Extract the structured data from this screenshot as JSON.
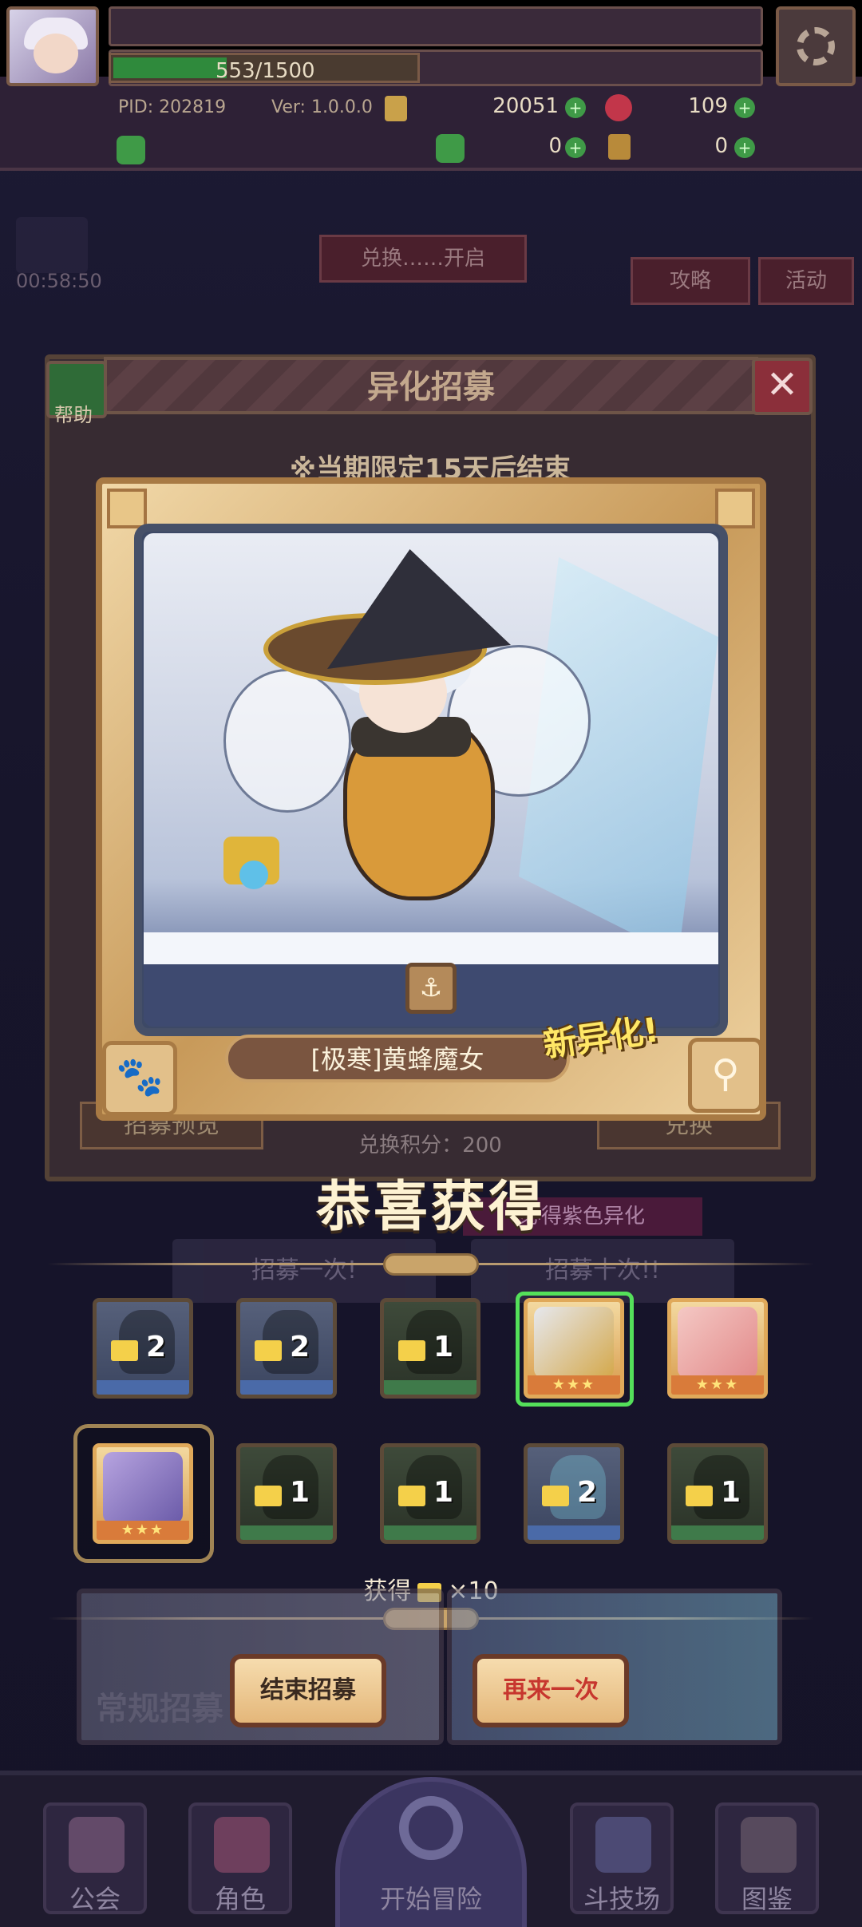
{
  "hud": {
    "pid": "PID: 202819",
    "version": "Ver: 1.0.0.0",
    "coins": "20051",
    "gems": "109",
    "xp_text": "553/1500",
    "xp_fraction": 0.369,
    "clover_count": "0",
    "key_count": "0"
  },
  "background": {
    "timer": "00:58:50",
    "strategy_label": "攻略",
    "activity_label": "活动",
    "exchange_open": "兑换……开启"
  },
  "window": {
    "title": "异化招募",
    "help_label": "帮助",
    "close_glyph": "✕",
    "limit_notice": "※当期限定15天后结束",
    "exchange_points": "兑换积分：200",
    "preview_label": "招募预览",
    "exchange_label": "兑换",
    "purple_hint": "必得紫色异化",
    "recruit_one": "招募一次!",
    "recruit_ten": "招募十次!!"
  },
  "card": {
    "character_name": "[极寒]黄蜂魔女",
    "new_badge": "新异化!",
    "paw_glyph": "🐾",
    "weapon_glyph": "⚲",
    "element_glyph": "⚓"
  },
  "result": {
    "title": "恭喜获得",
    "rewards_row1": [
      {
        "type": "shard",
        "rarity": "blue",
        "count": "2"
      },
      {
        "type": "shard",
        "rarity": "blue",
        "count": "2"
      },
      {
        "type": "shard",
        "rarity": "green",
        "count": "1"
      },
      {
        "type": "hero",
        "stars": "★★★",
        "highlight": "new"
      },
      {
        "type": "hero",
        "stars": "★★★"
      }
    ],
    "rewards_row2": [
      {
        "type": "hero",
        "stars": "★★★",
        "highlight": "selected"
      },
      {
        "type": "shard",
        "rarity": "green",
        "count": "1"
      },
      {
        "type": "shard",
        "rarity": "green",
        "count": "1"
      },
      {
        "type": "shard",
        "rarity": "blue",
        "count": "2"
      },
      {
        "type": "shard",
        "rarity": "green",
        "count": "1"
      }
    ],
    "obtain_prefix": "获得",
    "obtain_suffix": "×10"
  },
  "banners": {
    "normal_recruit": "常规招募"
  },
  "actions": {
    "end_label": "结束招募",
    "again_label": "再来一次"
  },
  "nav": {
    "guild": "公会",
    "character": "角色",
    "adventure": "开始冒险",
    "arena": "斗技场",
    "codex": "图鉴"
  },
  "colors": {
    "accent_gold": "#c9a46a",
    "new_badge": "#ffe766",
    "again_text": "#c7362e",
    "highlight_green": "#54e05a"
  }
}
